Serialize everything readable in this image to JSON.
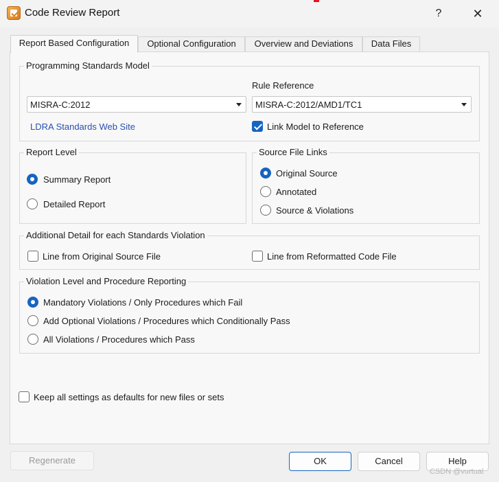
{
  "window": {
    "title": "Code Review Report",
    "help_label": "?",
    "close_label": "✕"
  },
  "tabs": [
    {
      "label": "Report Based Configuration",
      "active": true
    },
    {
      "label": "Optional Configuration",
      "active": false
    },
    {
      "label": "Overview and Deviations",
      "active": false
    },
    {
      "label": "Data Files",
      "active": false
    }
  ],
  "programming_standards": {
    "title": "Programming Standards Model",
    "model_value": "MISRA-C:2012",
    "rule_reference_label": "Rule Reference",
    "rule_reference_value": "MISRA-C:2012/AMD1/TC1",
    "web_link": "LDRA Standards Web Site",
    "link_model_label": "Link Model to Reference",
    "link_model_checked": true
  },
  "report_level": {
    "title": "Report Level",
    "options": [
      {
        "label": "Summary Report",
        "checked": true
      },
      {
        "label": "Detailed Report",
        "checked": false
      }
    ]
  },
  "source_file_links": {
    "title": "Source File Links",
    "options": [
      {
        "label": "Original Source",
        "checked": true
      },
      {
        "label": "Annotated",
        "checked": false
      },
      {
        "label": "Source & Violations",
        "checked": false
      }
    ]
  },
  "additional_detail": {
    "title": "Additional Detail for each Standards Violation",
    "options": [
      {
        "label": "Line from Original Source File",
        "checked": false
      },
      {
        "label": "Line from Reformatted Code File",
        "checked": false
      }
    ]
  },
  "violation_level": {
    "title": "Violation Level and Procedure Reporting",
    "options": [
      {
        "label": "Mandatory Violations / Only Procedures which Fail",
        "checked": true
      },
      {
        "label": "Add Optional Violations / Procedures which Conditionally Pass",
        "checked": false
      },
      {
        "label": "All Violations / Procedures which Pass",
        "checked": false
      }
    ]
  },
  "keep_defaults": {
    "label": "Keep all settings as defaults for new files or sets",
    "checked": false
  },
  "buttons": {
    "regenerate": "Regenerate",
    "ok": "OK",
    "cancel": "Cancel",
    "help": "Help"
  },
  "watermark": "CSDN @vurtual",
  "colors": {
    "accent": "#1565c0",
    "link": "#2b4fb0"
  }
}
